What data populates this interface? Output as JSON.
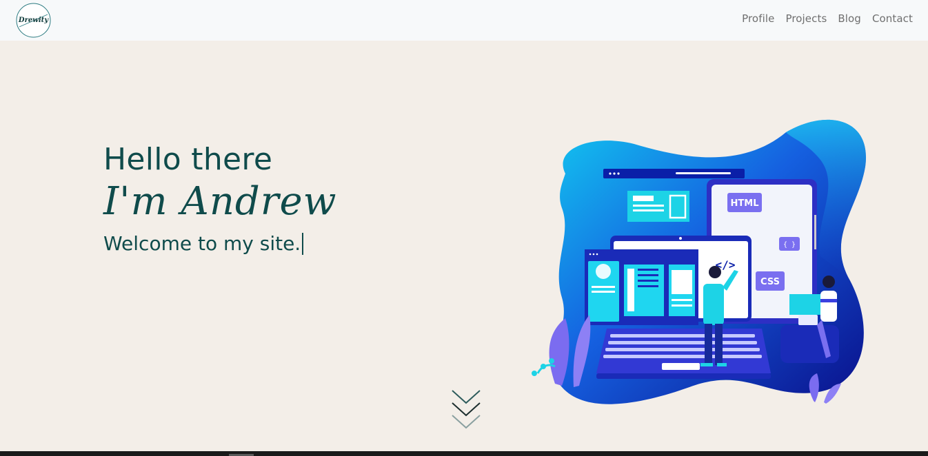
{
  "nav": {
    "logo_text": "Drewity",
    "links": [
      "Profile",
      "Projects",
      "Blog",
      "Contact"
    ]
  },
  "hero": {
    "greeting": "Hello there",
    "name": "I'm Andrew",
    "tagline": "Welcome to my site.",
    "illustration_labels": {
      "html": "HTML",
      "css": "CSS",
      "braces": "{ }",
      "code": "</>"
    }
  },
  "colors": {
    "text_primary": "#0f4b4b",
    "nav_text": "#6f6f6f",
    "background": "#f3eee8",
    "navbar_bg": "#f7f9fa",
    "accent_blue": "#1b4fd8",
    "accent_cyan": "#1dd3e6",
    "accent_purple": "#7b6cf0"
  },
  "icons": {
    "logo": "drewity-logo",
    "scroll": "chevrons-down-icon"
  }
}
